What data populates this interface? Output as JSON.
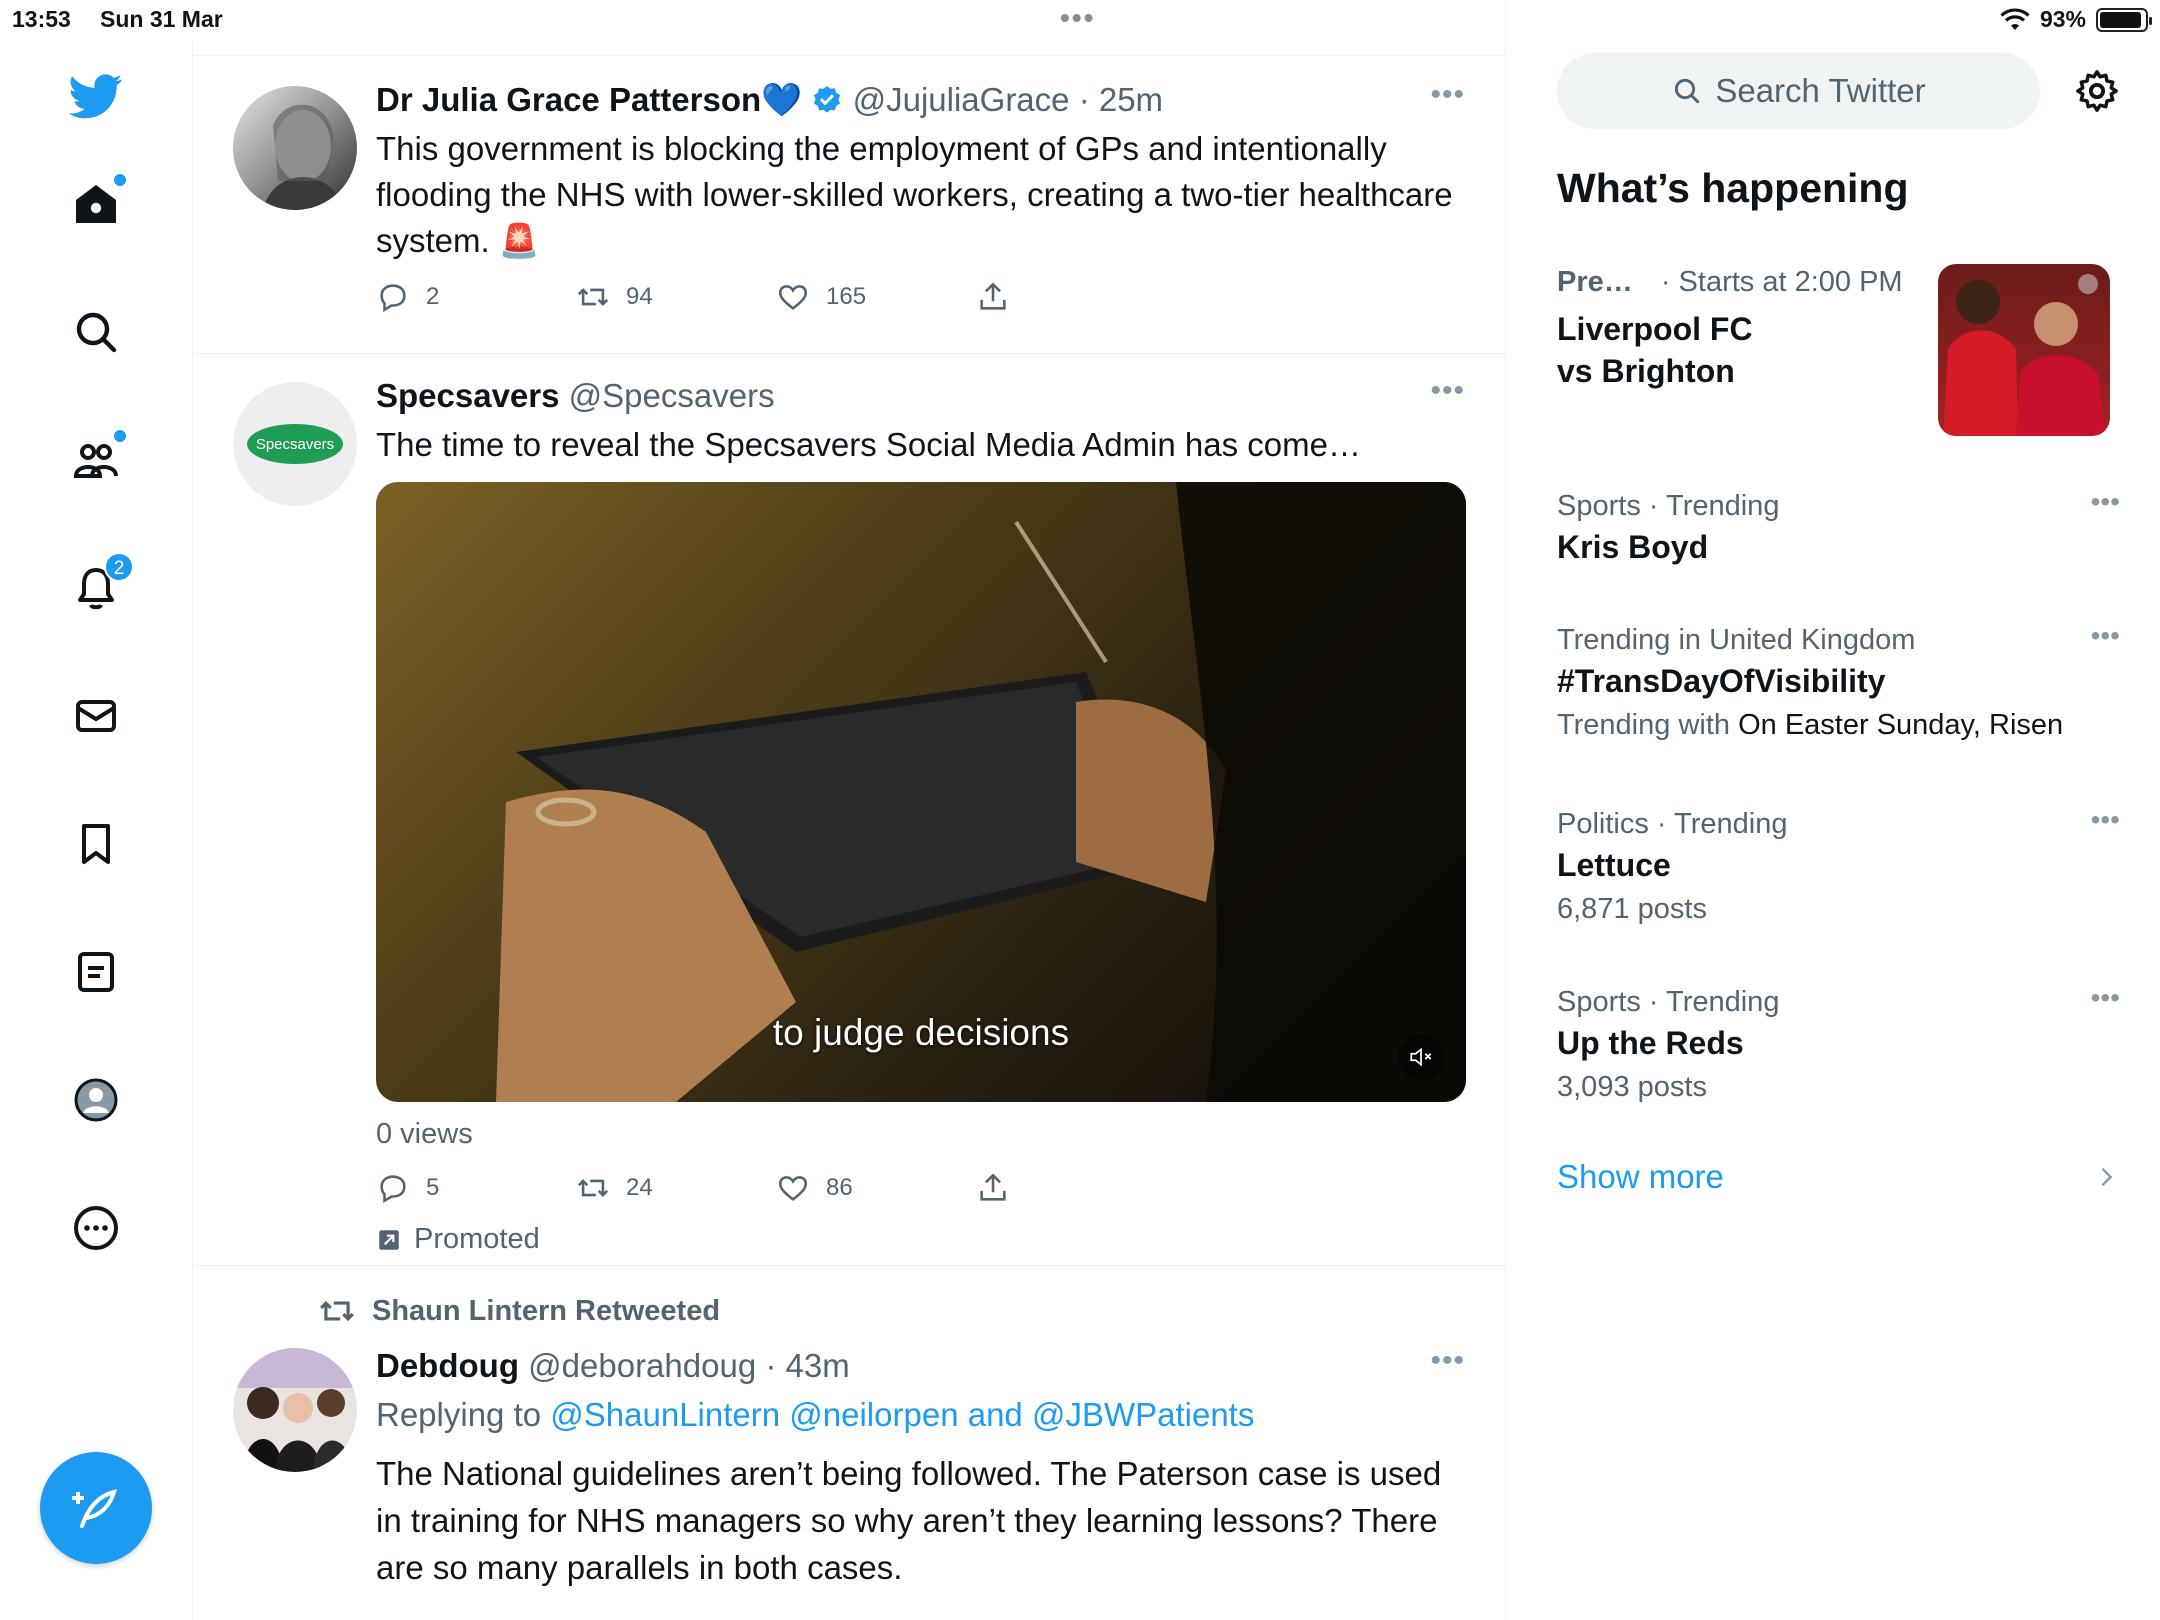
{
  "status_bar": {
    "time": "13:53",
    "date": "Sun 31 Mar",
    "battery": "93%",
    "battery_level": 0.93
  },
  "nav": {
    "notifications_badge": "2"
  },
  "tweets": [
    {
      "name": "Dr Julia Grace Patterson💙",
      "handle": "@JujuliaGrace",
      "time": "· 25m",
      "text": "This government is blocking the employment of GPs and intentionally flooding the NHS with lower-skilled workers, creating a two-tier healthcare system. 🚨",
      "replies": "2",
      "retweets": "94",
      "likes": "165"
    },
    {
      "name": "Specsavers",
      "handle": "@Specsavers",
      "avatar_label": "Specsavers",
      "text": "The time to reveal the Specsavers Social Media Admin has come…",
      "video_caption": "to judge decisions",
      "views": "0 views",
      "replies": "5",
      "retweets": "24",
      "likes": "86",
      "promoted": "Promoted"
    },
    {
      "retweeted_by": "Shaun Lintern Retweeted",
      "name": "Debdoug",
      "handle": "@deborahdoug",
      "time": "· 43m",
      "replying_prefix": "Replying to",
      "replying_to": "@ShaunLintern @neilorpen and @JBWPatients",
      "text": "The National guidelines aren’t being followed. The Paterson case is used in training for NHS managers so why aren’t they learning lessons? There are so many parallels in both cases."
    }
  ],
  "sidebar": {
    "search_placeholder": "Search Twitter",
    "title": "What’s happening",
    "featured": {
      "meta_a": "Pre…",
      "meta_b": "· Starts at 2:00 PM",
      "line1": "Liverpool FC",
      "line2": "vs Brighton"
    },
    "trends": [
      {
        "meta": "Sports · Trending",
        "topic": "Kris Boyd",
        "sub": ""
      },
      {
        "meta": "Trending in United Kingdom",
        "topic": "#TransDayOfVisibility",
        "sub_prefix": "Trending with",
        "sub": "On Easter Sunday, Risen"
      },
      {
        "meta": "Politics · Trending",
        "topic": "Lettuce",
        "sub": "6,871 posts"
      },
      {
        "meta": "Sports · Trending",
        "topic": "Up the Reds",
        "sub": "3,093 posts"
      }
    ],
    "show_more": "Show more"
  },
  "colors": {
    "accent": "#1d9bf0",
    "text": "#0f1419",
    "muted": "#536471"
  }
}
